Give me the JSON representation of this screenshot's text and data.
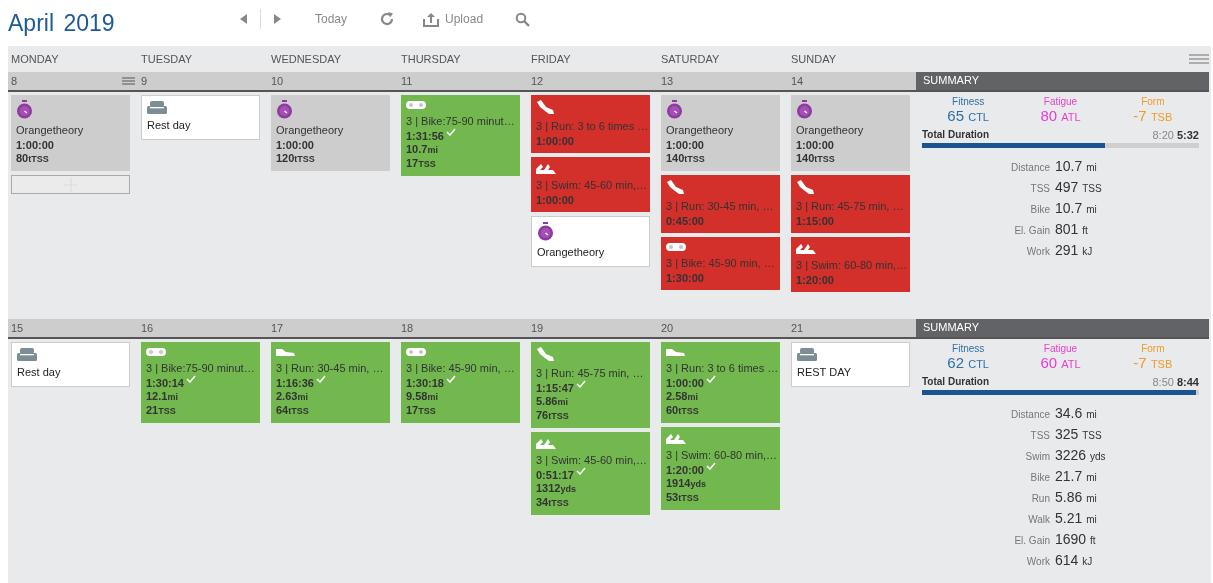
{
  "header": {
    "month": "April",
    "year": "2019",
    "today_label": "Today",
    "upload_label": "Upload"
  },
  "weekdays": [
    "MONDAY",
    "TUESDAY",
    "WEDNESDAY",
    "THURSDAY",
    "FRIDAY",
    "SATURDAY",
    "SUNDAY"
  ],
  "weeks": [
    {
      "days": [
        {
          "date": "8",
          "menu": true,
          "add_slot": true,
          "workouts": [
            {
              "kind": "timer",
              "color": "#cdcdcd",
              "title": "Orangetheory",
              "lines": [
                {
                  "value": "1:00:00"
                },
                {
                  "value": "80",
                  "unit": "tTSS"
                }
              ]
            }
          ]
        },
        {
          "date": "9",
          "workouts": [
            {
              "kind": "rest",
              "color": "#ffffff",
              "title": "Rest day"
            }
          ]
        },
        {
          "date": "10",
          "workouts": [
            {
              "kind": "timer",
              "color": "#cdcdcd",
              "title": "Orangetheory",
              "lines": [
                {
                  "value": "1:00:00"
                },
                {
                  "value": "120",
                  "unit": "tTSS"
                }
              ]
            }
          ]
        },
        {
          "date": "11",
          "workouts": [
            {
              "kind": "bike",
              "color": "#72b84f",
              "title": "3 | Bike:75-90 minut…",
              "checked": true,
              "lines": [
                {
                  "value": "1:31:56"
                },
                {
                  "value": "10.7",
                  "unit": "mi"
                },
                {
                  "value": "17",
                  "unit": "TSS"
                }
              ]
            }
          ]
        },
        {
          "date": "12",
          "workouts": [
            {
              "kind": "run",
              "color": "#d32f2b",
              "title": "3 | Run: 3 to 6 times …",
              "lines": [
                {
                  "value": "1:00:00"
                }
              ]
            },
            {
              "kind": "swim",
              "color": "#d32f2b",
              "title": "3 | Swim: 45-60 min,…",
              "lines": [
                {
                  "value": "1:00:00"
                }
              ]
            },
            {
              "kind": "timer",
              "color": "#ffffff",
              "title": "Orangetheory"
            }
          ]
        },
        {
          "date": "13",
          "workouts": [
            {
              "kind": "timer",
              "color": "#cdcdcd",
              "title": "Orangetheory",
              "lines": [
                {
                  "value": "1:00:00"
                },
                {
                  "value": "140",
                  "unit": "tTSS"
                }
              ]
            },
            {
              "kind": "run",
              "color": "#d32f2b",
              "title": "3 | Run: 30-45 min, …",
              "lines": [
                {
                  "value": "0:45:00"
                }
              ]
            },
            {
              "kind": "bike",
              "color": "#d32f2b",
              "title": "3 | Bike: 45-90 min, …",
              "lines": [
                {
                  "value": "1:30:00"
                }
              ]
            }
          ]
        },
        {
          "date": "14",
          "workouts": [
            {
              "kind": "timer",
              "color": "#cdcdcd",
              "title": "Orangetheory",
              "lines": [
                {
                  "value": "1:00:00"
                },
                {
                  "value": "140",
                  "unit": "tTSS"
                }
              ]
            },
            {
              "kind": "run",
              "color": "#d32f2b",
              "title": "3 | Run: 45-75 min, …",
              "lines": [
                {
                  "value": "1:15:00"
                }
              ]
            },
            {
              "kind": "swim",
              "color": "#d32f2b",
              "title": "3 | Swim: 60-80 min,…",
              "lines": [
                {
                  "value": "1:20:00"
                }
              ]
            }
          ]
        }
      ],
      "summary": {
        "title": "SUMMARY",
        "fitness": {
          "label": "Fitness",
          "value": "65",
          "unit": "CTL"
        },
        "fatigue": {
          "label": "Fatigue",
          "value": "80",
          "unit": "ATL"
        },
        "form": {
          "label": "Form",
          "value": "-7",
          "unit": "TSB"
        },
        "duration_label": "Total Duration",
        "planned": "8:20",
        "actual": "5:32",
        "level": 0.66,
        "stats": [
          {
            "label": "Distance",
            "value": "10.7",
            "unit": "mi"
          },
          {
            "label": "TSS",
            "value": "497",
            "unit": "TSS"
          },
          {
            "label": "Bike",
            "value": "10.7",
            "unit": "mi"
          },
          {
            "label": "El. Gain",
            "value": "801",
            "unit": "ft"
          },
          {
            "label": "Work",
            "value": "291",
            "unit": "kJ"
          }
        ]
      }
    },
    {
      "days": [
        {
          "date": "15",
          "workouts": [
            {
              "kind": "rest",
              "color": "#ffffff",
              "title": "Rest day"
            }
          ]
        },
        {
          "date": "16",
          "workouts": [
            {
              "kind": "bike",
              "color": "#72b84f",
              "title": "3 | Bike:75-90 minut…",
              "checked": true,
              "lines": [
                {
                  "value": "1:30:14"
                },
                {
                  "value": "12.1",
                  "unit": "mi"
                },
                {
                  "value": "21",
                  "unit": "TSS"
                }
              ]
            }
          ]
        },
        {
          "date": "17",
          "workouts": [
            {
              "kind": "shoe",
              "color": "#72b84f",
              "title": "3 | Run: 30-45 min, …",
              "checked": true,
              "lines": [
                {
                  "value": "1:16:36"
                },
                {
                  "value": "2.63",
                  "unit": "mi"
                },
                {
                  "value": "64",
                  "unit": "tTSS"
                }
              ]
            }
          ]
        },
        {
          "date": "18",
          "workouts": [
            {
              "kind": "bike",
              "color": "#72b84f",
              "title": "3 | Bike: 45-90 min, …",
              "checked": true,
              "lines": [
                {
                  "value": "1:30:18"
                },
                {
                  "value": "9.58",
                  "unit": "mi"
                },
                {
                  "value": "17",
                  "unit": "TSS"
                }
              ]
            }
          ]
        },
        {
          "date": "19",
          "workouts": [
            {
              "kind": "run",
              "color": "#72b84f",
              "title": "3 | Run: 45-75 min, …",
              "checked": true,
              "lines": [
                {
                  "value": "1:15:47"
                },
                {
                  "value": "5.86",
                  "unit": "mi"
                },
                {
                  "value": "76",
                  "unit": "tTSS"
                }
              ]
            },
            {
              "kind": "swim",
              "color": "#72b84f",
              "title": "3 | Swim: 45-60 min,…",
              "checked": true,
              "lines": [
                {
                  "value": "0:51:17"
                },
                {
                  "value": "1312",
                  "unit": "yds"
                },
                {
                  "value": "34",
                  "unit": "tTSS"
                }
              ]
            }
          ]
        },
        {
          "date": "20",
          "workouts": [
            {
              "kind": "shoe",
              "color": "#72b84f",
              "title": "3 | Run: 3 to 6 times …",
              "checked": true,
              "lines": [
                {
                  "value": "1:00:00"
                },
                {
                  "value": "2.58",
                  "unit": "mi"
                },
                {
                  "value": "60",
                  "unit": "tTSS"
                }
              ]
            },
            {
              "kind": "swim",
              "color": "#72b84f",
              "title": "3 | Swim: 60-80 min,…",
              "checked": true,
              "lines": [
                {
                  "value": "1:20:00"
                },
                {
                  "value": "1914",
                  "unit": "yds"
                },
                {
                  "value": "53",
                  "unit": "tTSS"
                }
              ]
            }
          ]
        },
        {
          "date": "21",
          "workouts": [
            {
              "kind": "rest",
              "color": "#ffffff",
              "title": "REST DAY"
            }
          ]
        }
      ],
      "summary": {
        "title": "SUMMARY",
        "fitness": {
          "label": "Fitness",
          "value": "62",
          "unit": "CTL"
        },
        "fatigue": {
          "label": "Fatigue",
          "value": "60",
          "unit": "ATL"
        },
        "form": {
          "label": "Form",
          "value": "-7",
          "unit": "TSB"
        },
        "duration_label": "Total Duration",
        "planned": "8:50",
        "actual": "8:44",
        "level": 0.99,
        "stats": [
          {
            "label": "Distance",
            "value": "34.6",
            "unit": "mi"
          },
          {
            "label": "TSS",
            "value": "325",
            "unit": "TSS"
          },
          {
            "label": "Swim",
            "value": "3226",
            "unit": "yds"
          },
          {
            "label": "Bike",
            "value": "21.7",
            "unit": "mi"
          },
          {
            "label": "Run",
            "value": "5.86",
            "unit": "mi"
          },
          {
            "label": "Walk",
            "value": "5.21",
            "unit": "mi"
          },
          {
            "label": "El. Gain",
            "value": "1690",
            "unit": "ft"
          },
          {
            "label": "Work",
            "value": "614",
            "unit": "kJ"
          }
        ]
      }
    }
  ]
}
